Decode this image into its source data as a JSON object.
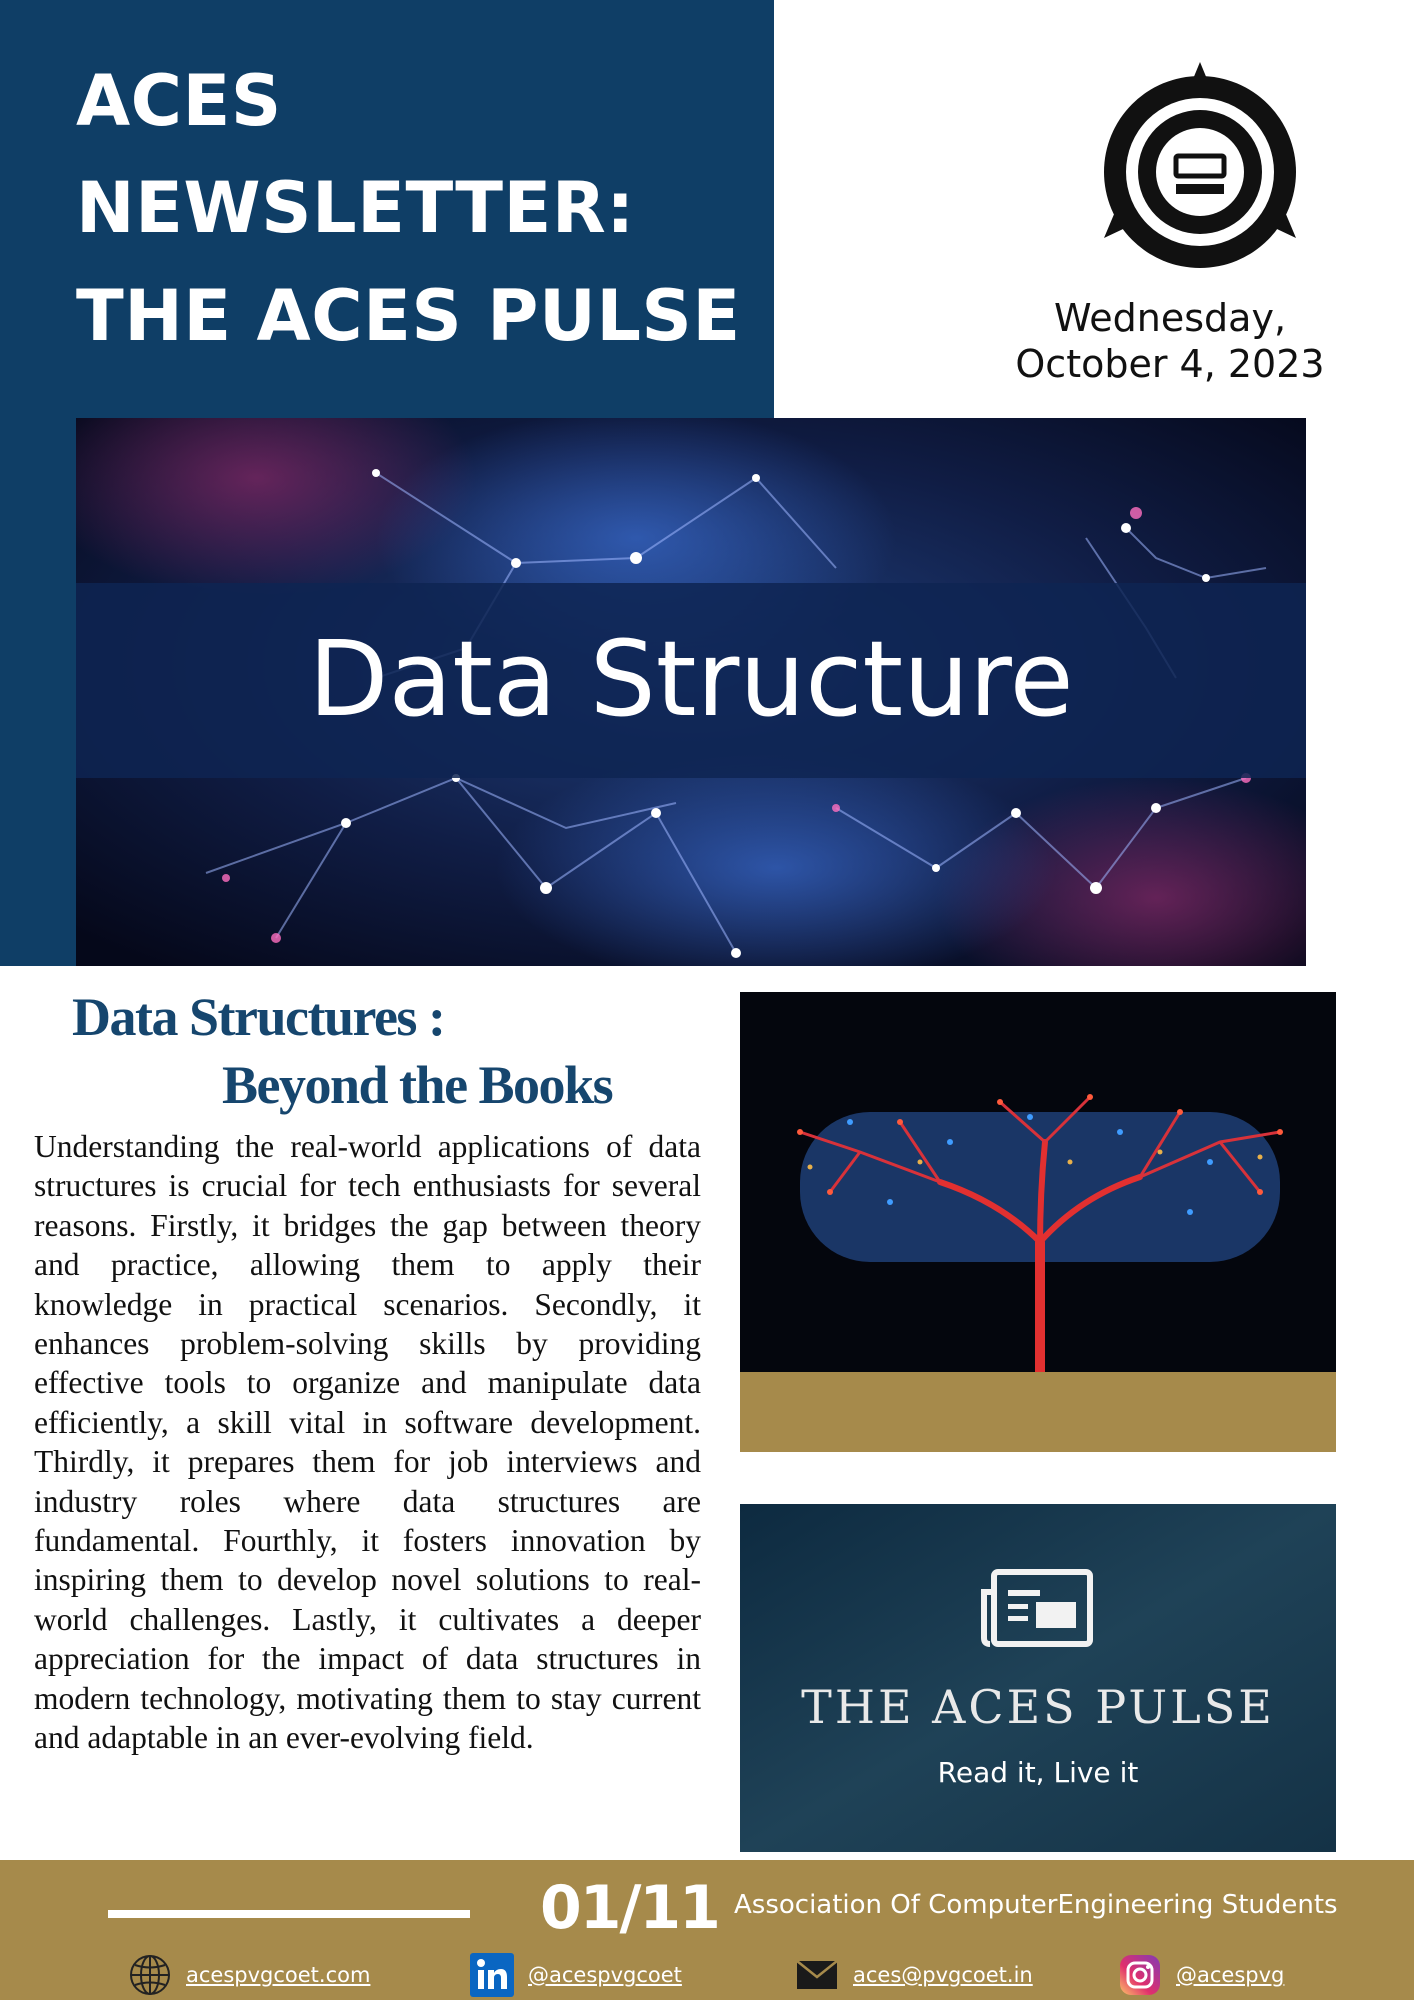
{
  "header": {
    "title_lines": [
      "ACES",
      "NEWSLETTER:",
      "THE ACES PULSE"
    ],
    "date_lines": [
      "Wednesday,",
      "October 4, 2023"
    ],
    "logo_icon": "aces-emblem-icon"
  },
  "hero": {
    "banner_text": "Data Structure"
  },
  "article": {
    "title_line1": "Data Structures :",
    "title_line2": "Beyond the Books",
    "body": "Understanding the real-world applications of data structures is crucial for tech enthusiasts for several reasons. Firstly, it bridges the gap between theory and practice, allowing them to apply their knowledge in practical scenarios. Secondly, it enhances problem-solving skills by providing effective tools to organize and manipulate data efficiently, a skill vital in software development. Thirdly, it prepares them for job interviews and industry roles where data structures are fundamental. Fourthly, it fosters innovation by inspiring them to develop novel solutions to real-world challenges. Lastly, it cultivates a deeper appreciation for the impact of data structures in modern technology, motivating them to stay current and adaptable in an ever-evolving field."
  },
  "pulse_card": {
    "title": "THE ACES PULSE",
    "tagline": "Read it, Live it",
    "icon": "newspaper-icon"
  },
  "footer": {
    "page_number": "01/11",
    "org_name": "Association Of ComputerEngineering Students",
    "contacts": [
      {
        "icon": "globe-icon",
        "text": "acespvgcoet.com"
      },
      {
        "icon": "linkedin-icon",
        "text": "@acespvgcoet"
      },
      {
        "icon": "mail-icon",
        "text": "aces@pvgcoet.in"
      },
      {
        "icon": "instagram-icon",
        "text": "@acespvg"
      }
    ]
  },
  "colors": {
    "navy": "#0f3e66",
    "gold": "#a68a4b",
    "heading_blue": "#16466e"
  }
}
